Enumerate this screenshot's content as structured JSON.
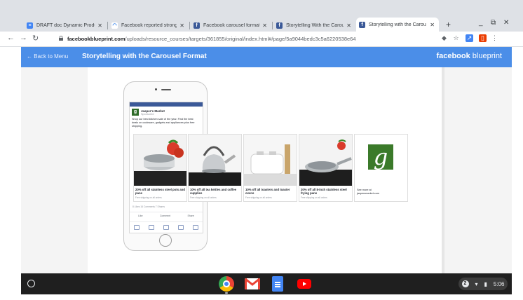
{
  "browser": {
    "tabs": [
      {
        "title": "DRAFT doc Dynamic Produ",
        "icon": "docs-icon",
        "color": "#4285f4",
        "active": false
      },
      {
        "title": "Facebook reported strong r",
        "icon": "wifi-icon",
        "color": "#1a73e8",
        "active": false
      },
      {
        "title": "Facebook carousel format:",
        "icon": "facebook-icon",
        "color": "#3b5998",
        "active": false
      },
      {
        "title": "Storytelling With the Carou",
        "icon": "facebook-icon",
        "color": "#3b5998",
        "active": false
      },
      {
        "title": "Storytelling with the Carou",
        "icon": "facebook-icon",
        "color": "#3b5998",
        "active": true
      }
    ],
    "new_tab": "+",
    "url_host": "facebookblueprint.com",
    "url_path": "/uploads/resource_courses/targets/361855/original/index.html#/page/5a9044bedc3c5a6220538e64"
  },
  "header": {
    "back_label": "Back to Menu",
    "title": "Storytelling with the Carousel Format",
    "brand_bold": "facebook",
    "brand_light": "blueprint",
    "color": "#4b8ee8"
  },
  "phone": {
    "page_name": "Jasper's Market",
    "sponsored": "Sponsored",
    "post_text": "Shop our best kitchen sale of the year. Find the best deals on cookware, gadgets and appliances plus free shipping.",
    "stats": "8 Likes  16 Comments  7 Shares",
    "like": "Like",
    "comment": "Comment",
    "share": "Share"
  },
  "carousel": [
    {
      "title": "20% off all stainless steel pots and pans",
      "sub": "Free shipping on all orders"
    },
    {
      "title": "10% off all tea kettles and coffee supplies",
      "sub": "Free shipping on all orders"
    },
    {
      "title": "10% off all toasters and toaster ovens",
      "sub": "Free shipping on all orders"
    },
    {
      "title": "20% off all 8-inch stainless steel frying pans",
      "sub": "Free shipping on all orders"
    }
  ],
  "see_more": {
    "line1": "See more at",
    "line2": "jaspersmarket.com",
    "logo": "g"
  },
  "tray": {
    "notifications": "2",
    "time": "5:06"
  }
}
